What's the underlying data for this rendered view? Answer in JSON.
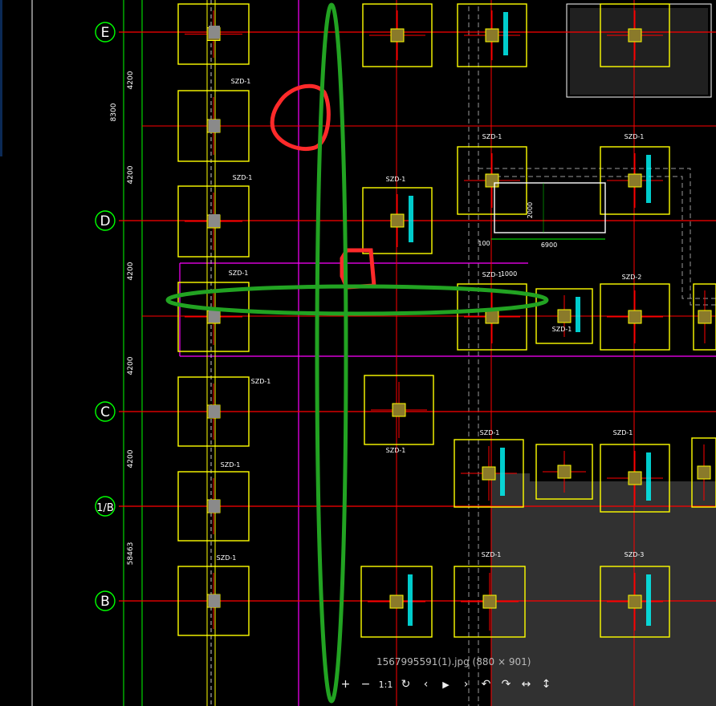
{
  "viewer": {
    "caption": "1567995591(1).jpg (880 × 901)",
    "toolbar": [
      {
        "name": "zoom-in-button",
        "glyph": "+"
      },
      {
        "name": "zoom-out-button",
        "glyph": "−"
      },
      {
        "name": "actual-size-button",
        "glyph": "1:1"
      },
      {
        "name": "rotate-button",
        "glyph": "↻"
      },
      {
        "name": "previous-button",
        "glyph": "‹"
      },
      {
        "name": "play-button",
        "glyph": "▶"
      },
      {
        "name": "next-button",
        "glyph": "›"
      },
      {
        "name": "rotate-left-button",
        "glyph": "↶"
      },
      {
        "name": "rotate-right-button",
        "glyph": "↷"
      },
      {
        "name": "flip-horizontal-button",
        "glyph": "↔"
      },
      {
        "name": "flip-vertical-button",
        "glyph": "↕"
      }
    ]
  },
  "drawing": {
    "axis_labels": [
      "E",
      "D",
      "C",
      "1/B",
      "B"
    ],
    "dimensions": [
      "4200",
      "4200",
      "4200",
      "4200",
      "4200",
      "58463",
      "8300"
    ],
    "footing_tags": [
      "SZD-1",
      "SZD-1",
      "SZD-1",
      "SZD-1",
      "SZD-1",
      "SZD-1",
      "SZD-1",
      "SZD-1",
      "SZD-1",
      "SZD-1",
      "SZD-1",
      "SZD-2",
      "SZD-1",
      "SZD-1",
      "SZD-1",
      "SZD-1",
      "SZD-3"
    ],
    "box_dimensions": [
      "2000",
      "6900",
      "100",
      "1000"
    ],
    "colors": {
      "background": "#000000",
      "grid_red": "#ff0000",
      "footing_yellow": "#ffff00",
      "dim_green": "#00ff00",
      "magenta": "#ff00ff",
      "cyan_text": "#00ffff",
      "markup_green": "#1fa51f",
      "markup_red": "#ff2020"
    }
  }
}
